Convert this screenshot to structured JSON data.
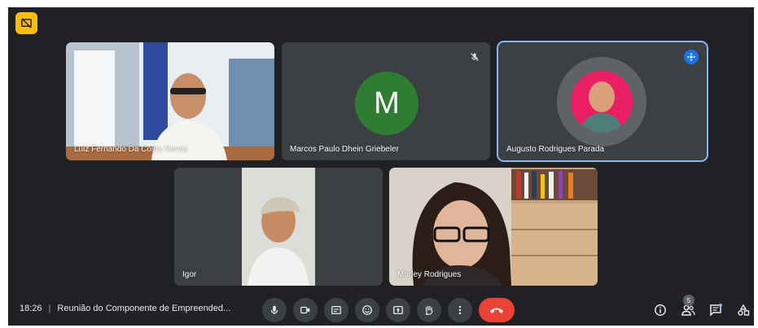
{
  "participants": [
    {
      "name": "Luiz Fernando Da Costa Neves"
    },
    {
      "name": "Marcos Paulo Dhein Griebeler",
      "initial": "M"
    },
    {
      "name": "Augusto Rodrigues Parada"
    },
    {
      "name": "Igor"
    },
    {
      "name": "Marley Rodrigues"
    }
  ],
  "bar": {
    "time": "18:26",
    "separator": "|",
    "meeting_title": "Reunião do Componente de Empreended...",
    "participant_count": "5"
  },
  "colors": {
    "background": "#202124",
    "tile": "#3c4043",
    "end_call": "#ea4335",
    "active_border": "#8ab4f8",
    "badge": "#fbbc04",
    "avatar_green": "#2e7d32"
  },
  "icons": {
    "top_left": "presentation-off-icon",
    "muted": "mic-off-icon",
    "pin": "pin-icon",
    "controls": [
      "mic-icon",
      "camera-icon",
      "captions-icon",
      "emoji-icon",
      "present-icon",
      "raise-hand-icon",
      "more-options-icon",
      "end-call-icon"
    ],
    "right": [
      "info-icon",
      "people-icon",
      "chat-icon",
      "activities-icon"
    ]
  }
}
